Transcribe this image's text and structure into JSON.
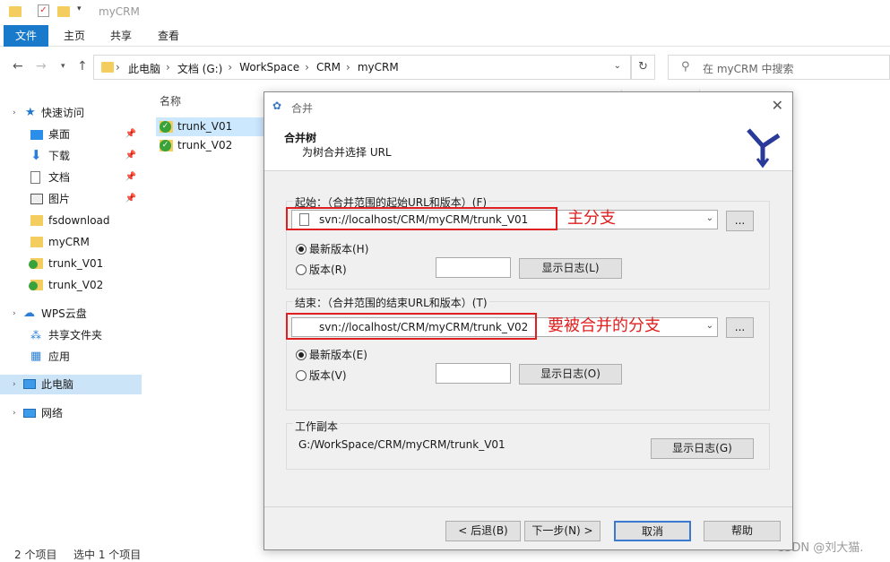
{
  "window": {
    "title": "myCRM"
  },
  "ribbon": {
    "tabs": [
      "文件",
      "主页",
      "共享",
      "查看"
    ]
  },
  "address": {
    "crumbs": [
      "此电脑",
      "文档 (G:)",
      "WorkSpace",
      "CRM",
      "myCRM"
    ],
    "search_placeholder": "在 myCRM 中搜索"
  },
  "nav": {
    "items": [
      {
        "label": "快速访问",
        "icon": "star-icon"
      },
      {
        "label": "桌面",
        "icon": "desktop-icon",
        "pinned": true
      },
      {
        "label": "下载",
        "icon": "download-icon",
        "pinned": true
      },
      {
        "label": "文档",
        "icon": "document-icon",
        "pinned": true
      },
      {
        "label": "图片",
        "icon": "picture-icon",
        "pinned": true
      },
      {
        "label": "fsdownload",
        "icon": "folder-icon"
      },
      {
        "label": "myCRM",
        "icon": "folder-icon"
      },
      {
        "label": "trunk_V01",
        "icon": "svn-folder-icon"
      },
      {
        "label": "trunk_V02",
        "icon": "svn-folder-icon"
      },
      {
        "label": "WPS云盘",
        "icon": "cloud-icon"
      },
      {
        "label": "共享文件夹",
        "icon": "share-icon"
      },
      {
        "label": "应用",
        "icon": "apps-icon"
      },
      {
        "label": "此电脑",
        "icon": "computer-icon"
      },
      {
        "label": "网络",
        "icon": "network-icon"
      }
    ]
  },
  "files": {
    "header": "名称",
    "items": [
      "trunk_V01",
      "trunk_V02"
    ]
  },
  "status": {
    "count": "2 个项目",
    "selected": "选中 1 个项目"
  },
  "watermark": "CSDN @刘大猫.",
  "dialog": {
    "title": "合并",
    "heading": "合并树",
    "subheading": "为树合并选择 URL",
    "from": {
      "label": "起始：（合并范围的起始URL和版本）(F)",
      "url": "svn://localhost/CRM/myCRM/trunk_V01",
      "latest": "最新版本(H)",
      "revision": "版本(R)",
      "showlog": "显示日志(L)",
      "annotation": "主分支"
    },
    "to": {
      "label": "结束：（合并范围的结束URL和版本）(T)",
      "url": "svn://localhost/CRM/myCRM/trunk_V02",
      "latest": "最新版本(E)",
      "revision": "版本(V)",
      "showlog": "显示日志(O)",
      "annotation": "要被合并的分支"
    },
    "wc": {
      "label": "工作副本",
      "path": "G:/WorkSpace/CRM/myCRM/trunk_V01",
      "showlog": "显示日志(G)"
    },
    "buttons": {
      "back": "< 后退(B)",
      "next": "下一步(N) >",
      "cancel": "取消",
      "help": "帮助"
    },
    "browse": "..."
  },
  "colors": {
    "accent": "#1979ca",
    "annotation": "#e02020"
  }
}
